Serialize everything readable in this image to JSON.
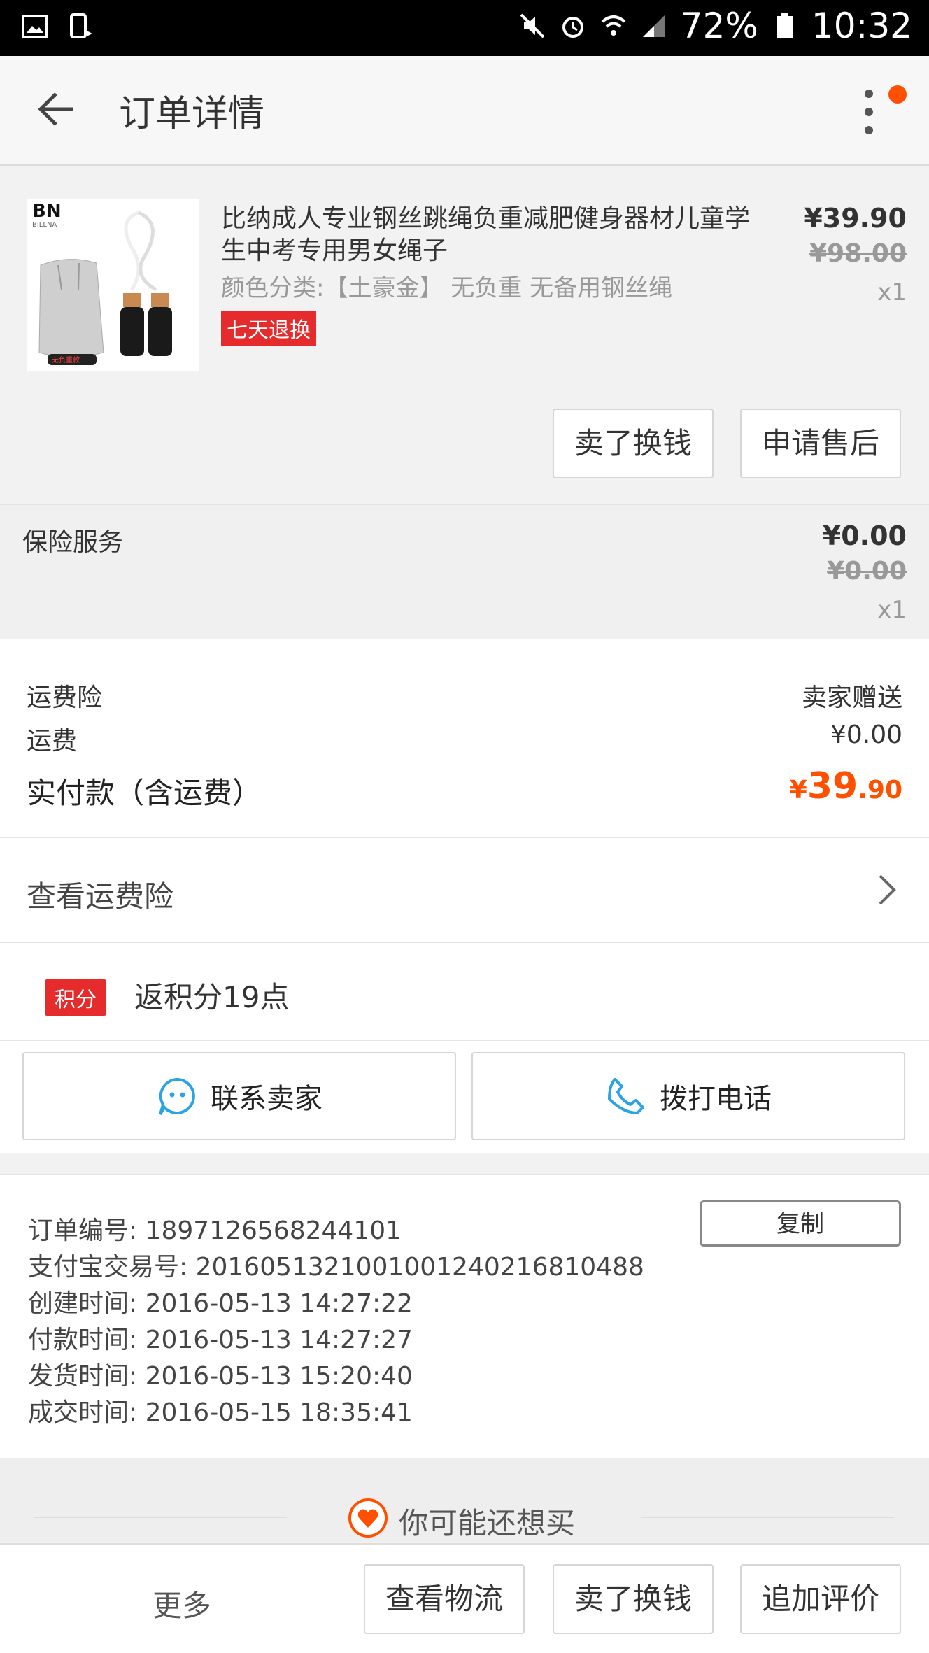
{
  "status_bar": {
    "battery": "72%",
    "time": "10:32"
  },
  "header": {
    "title": "订单详情"
  },
  "product": {
    "title": "比纳成人专业钢丝跳绳负重减肥健身器材儿童学生中考专用男女绳子",
    "sku": "颜色分类:【土豪金】 无负重 无备用钢丝绳",
    "badge": "七天退换",
    "price": "¥39.90",
    "original_price": "¥98.00",
    "quantity": "x1",
    "image_brand": "BN",
    "image_brand_sub": "BILLNA",
    "image_tag": "无负重款",
    "actions": [
      "卖了换钱",
      "申请售后"
    ]
  },
  "insurance": {
    "label": "保险服务",
    "price": "¥0.00",
    "original_price": "¥0.00",
    "quantity": "x1"
  },
  "fees": {
    "freight_insurance_label": "运费险",
    "freight_insurance_value": "卖家赠送",
    "shipping_label": "运费",
    "shipping_value": "¥0.00",
    "total_label": "实付款（含运费）",
    "total_currency": "¥",
    "total_int": "39",
    "total_dec": ".90"
  },
  "freight_link": {
    "label": "查看运费险"
  },
  "points": {
    "badge": "积分",
    "text": "返积分19点"
  },
  "contact": {
    "seller_label": "联系卖家",
    "phone_label": "拨打电话"
  },
  "order_info": {
    "order_no": "订单编号: 1897126568244101",
    "alipay_no": "支付宝交易号: 2016051321001001240216810488",
    "created": "创建时间: 2016-05-13 14:27:22",
    "paid": "付款时间: 2016-05-13 14:27:27",
    "shipped": "发货时间: 2016-05-13 15:20:40",
    "completed": "成交时间: 2016-05-15 18:35:41",
    "copy_label": "复制"
  },
  "recommend": {
    "title": "你可能还想买"
  },
  "bottom_bar": {
    "more": "更多",
    "actions": [
      "查看物流",
      "卖了换钱",
      "追加评价"
    ]
  },
  "colors": {
    "accent": "#ff5000",
    "badge_red": "#e52b2b",
    "icon_blue": "#2aa3e8"
  }
}
